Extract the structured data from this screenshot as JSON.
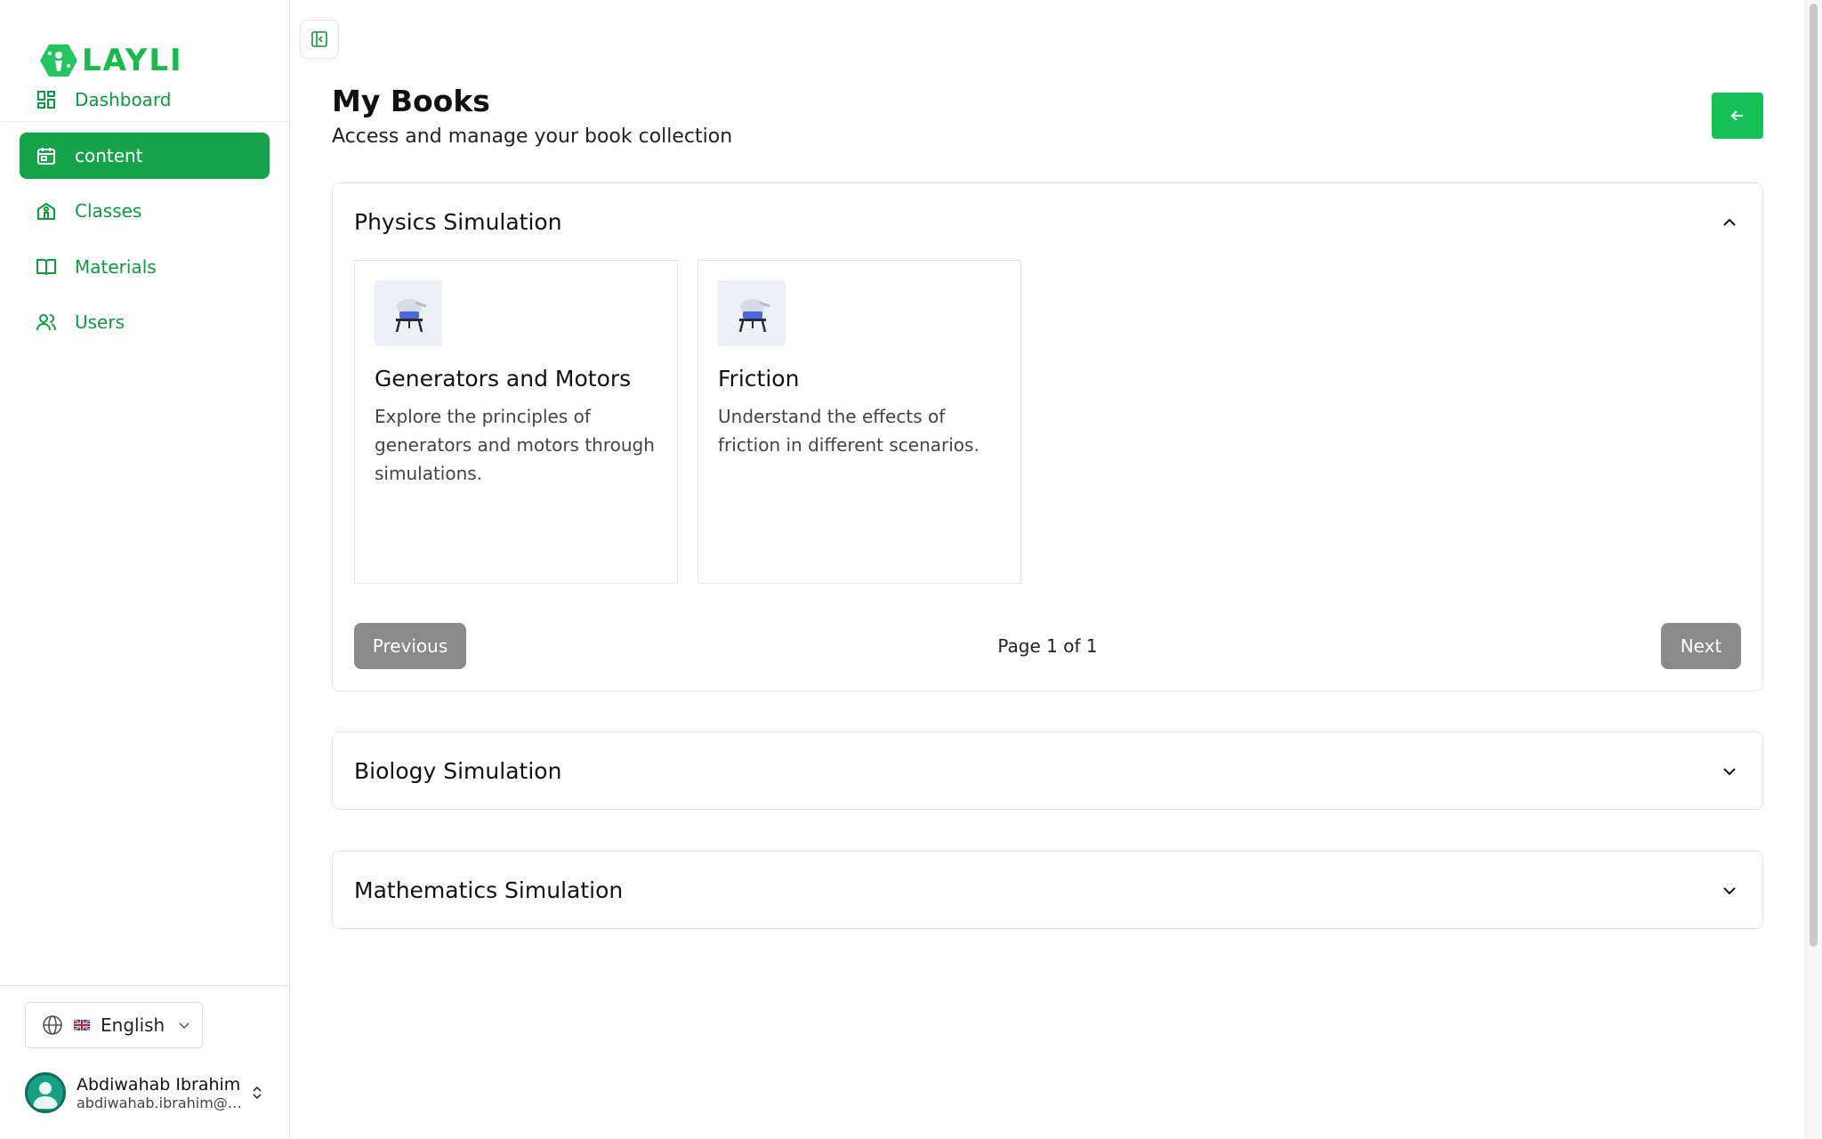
{
  "brand": {
    "name": "LAYLI",
    "color": "#1ab94b"
  },
  "sidebar": {
    "items": [
      {
        "label": "Dashboard",
        "icon": "dashboard-grid-icon",
        "active": false
      },
      {
        "label": "content",
        "icon": "content-calendar-icon",
        "active": true
      },
      {
        "label": "Classes",
        "icon": "school-building-icon",
        "active": false
      },
      {
        "label": "Materials",
        "icon": "open-book-icon",
        "active": false
      },
      {
        "label": "Users",
        "icon": "users-icon",
        "active": false
      }
    ]
  },
  "language": {
    "selected": "English",
    "icon": "globe-icon",
    "flag": "uk-flag-icon"
  },
  "user": {
    "name": "Abdiwahab Ibrahim",
    "email": "abdiwahab.ibrahim@s..."
  },
  "page": {
    "title": "My Books",
    "subtitle": "Access and manage your book collection"
  },
  "sections": [
    {
      "title": "Physics Simulation",
      "expanded": true,
      "cards": [
        {
          "title": "Generators and Motors",
          "description": "Explore the principles of generators and motors through simulations."
        },
        {
          "title": "Friction",
          "description": "Understand the effects of friction in different scenarios."
        }
      ],
      "pager": {
        "previous": "Previous",
        "info": "Page 1 of 1",
        "next": "Next"
      }
    },
    {
      "title": "Biology Simulation",
      "expanded": false
    },
    {
      "title": "Mathematics Simulation",
      "expanded": false
    }
  ],
  "colors": {
    "primary": "#16a34a",
    "back_button": "#15c155",
    "pager_button": "#8a8a8a"
  }
}
